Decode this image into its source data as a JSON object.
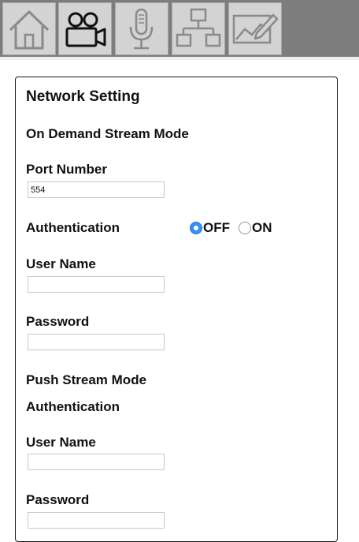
{
  "nav": {
    "tabs": [
      {
        "icon": "home-icon"
      },
      {
        "icon": "video-camera-icon"
      },
      {
        "icon": "microphone-icon"
      },
      {
        "icon": "network-icon"
      },
      {
        "icon": "image-settings-icon"
      }
    ]
  },
  "panel": {
    "title": "Network Setting",
    "on_demand": {
      "heading": "On Demand Stream Mode",
      "port_label": "Port Number",
      "port_value": "554",
      "auth_label": "Authentication",
      "auth_off": "OFF",
      "auth_on": "ON",
      "auth_selected": "OFF",
      "username_label": "User Name",
      "username_value": "",
      "password_label": "Password",
      "password_value": ""
    },
    "push": {
      "heading": "Push Stream Mode",
      "auth_label": "Authentication",
      "username_label": "User Name",
      "username_value": "",
      "password_label": "Password",
      "password_value": ""
    }
  },
  "colors": {
    "topbar": "#7d7d7d",
    "tab_bg": "#d3d3d3",
    "radio_selected": "#3a8ff0"
  }
}
